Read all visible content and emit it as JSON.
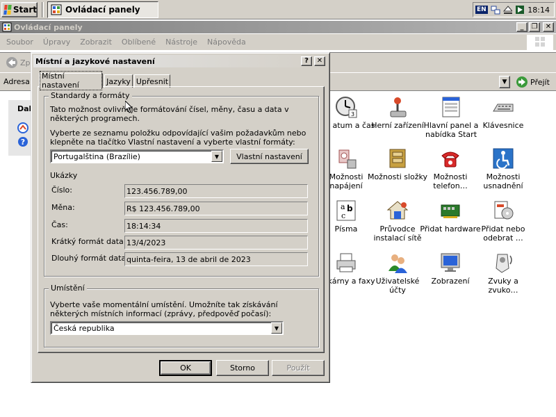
{
  "taskbar": {
    "start_label": "Start",
    "task_label": "Ovládací panely",
    "lang": "EN",
    "clock": "18:14"
  },
  "window": {
    "title": "Ovládací panely",
    "menu": [
      "Soubor",
      "Úpravy",
      "Zobrazit",
      "Oblíbené",
      "Nástroje",
      "Nápověda"
    ],
    "back_label": "Zp",
    "address_label": "Adresa",
    "go_label": "Přejít",
    "left_title": "Dal"
  },
  "items": [
    {
      "label": "atum a čas",
      "icon": "clock-icon"
    },
    {
      "label": "Herní zařízení",
      "icon": "joystick-icon"
    },
    {
      "label": "Hlavní panel a nabídka Start",
      "icon": "taskbar-icon"
    },
    {
      "label": "Klávesnice",
      "icon": "keyboard-icon"
    },
    {
      "label": "Možnosti napájení",
      "icon": "power-icon"
    },
    {
      "label": "Možnosti složky",
      "icon": "folder-icon"
    },
    {
      "label": "Možnosti telefon…",
      "icon": "phone-icon"
    },
    {
      "label": "Možnosti usnadnění",
      "icon": "accessibility-icon"
    },
    {
      "label": "Písma",
      "icon": "fonts-icon"
    },
    {
      "label": "Průvodce instalací sítě",
      "icon": "network-setup-icon"
    },
    {
      "label": "Přidat hardware",
      "icon": "hardware-icon"
    },
    {
      "label": "Přidat nebo odebrat …",
      "icon": "add-remove-icon"
    },
    {
      "label": "Tiskárny a faxy",
      "icon": "printer-icon"
    },
    {
      "label": "Uživatelské účty",
      "icon": "users-icon"
    },
    {
      "label": "Zobrazení",
      "icon": "display-icon"
    },
    {
      "label": "Zvuky a zvuko…",
      "icon": "sound-icon"
    }
  ],
  "dialog": {
    "title": "Místní a jazykové nastavení",
    "help_label": "?",
    "close_label": "✕",
    "tabs": [
      "Místní nastavení",
      "Jazyky",
      "Upřesnit"
    ],
    "standards": {
      "title": "Standardy a formáty",
      "desc": "Tato možnost ovlivňuje formátování čísel, měny, času a data v některých programech.",
      "instr": "Vyberte ze seznamu položku odpovídající vašim požadavkům nebo klepněte na tlačítko Vlastní nastavení a vyberte vlastní formáty:",
      "selected": "Portugalština (Brazílie)",
      "custom_button": "Vlastní nastavení",
      "samples_title": "Ukázky",
      "samples": [
        {
          "label": "Číslo:",
          "value": "123.456.789,00"
        },
        {
          "label": "Měna:",
          "value": "R$ 123.456.789,00"
        },
        {
          "label": "Čas:",
          "value": "18:14:34"
        },
        {
          "label": "Krátký formát data:",
          "value": "13/4/2023"
        },
        {
          "label": "Dlouhý formát data:",
          "value": "quinta-feira, 13 de abril de 2023"
        }
      ]
    },
    "location": {
      "title": "Umístění",
      "desc": "Vyberte vaše momentální umístění. Umožníte tak získávání některých místních informací (zprávy, předpověď počasí):",
      "selected": "Česká republika"
    },
    "buttons": {
      "ok": "OK",
      "cancel": "Storno",
      "apply": "Použít"
    }
  }
}
